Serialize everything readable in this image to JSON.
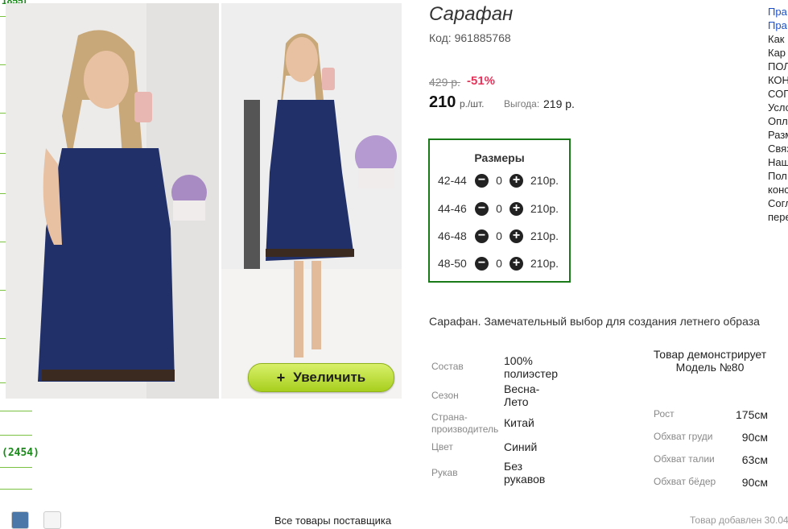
{
  "sidebar": {
    "top_fragment": "1855)",
    "count": "(2454)"
  },
  "gallery": {
    "zoom_label": "Увеличить",
    "zoom_icon": "plus-icon"
  },
  "product": {
    "title": "Сарафан",
    "code": "Код: 961885768",
    "old_price": "429 р.",
    "discount": "-51%",
    "price": "210",
    "price_unit": "р./шт.",
    "benefit_label": "Выгода:",
    "benefit_value": "219 р."
  },
  "sizes": {
    "title": "Размеры",
    "rows": [
      {
        "size": "42-44",
        "qty": "0",
        "price": "210р."
      },
      {
        "size": "44-46",
        "qty": "0",
        "price": "210р."
      },
      {
        "size": "46-48",
        "qty": "0",
        "price": "210р."
      },
      {
        "size": "48-50",
        "qty": "0",
        "price": "210р."
      }
    ]
  },
  "description": "Сарафан. Замечательный выбор для создания летнего образа",
  "attributes": [
    {
      "label": "Состав",
      "value": "100% полиэстер"
    },
    {
      "label": "Сезон",
      "value": "Весна-Лето"
    },
    {
      "label": "Страна-производитель",
      "value": "Китай"
    },
    {
      "label": "Цвет",
      "value": "Синий"
    },
    {
      "label": "Рукав",
      "value": "Без рукавов"
    }
  ],
  "model": {
    "heading": "Товар демонстрирует Модель №80",
    "measures": [
      {
        "label": "Рост",
        "value": "175см"
      },
      {
        "label": "Обхват груди",
        "value": "90см"
      },
      {
        "label": "Обхват талии",
        "value": "63см"
      },
      {
        "label": "Обхват бёдер",
        "value": "90см"
      }
    ]
  },
  "right_links": [
    "Пра",
    "Пра",
    "Как",
    "Кар",
    "ПОЛ",
    "КОН",
    "СОГ",
    "Усло",
    "Опл",
    "Разм",
    "Связ",
    "Нащ",
    "Пол",
    "конс",
    "Согл",
    "пере"
  ],
  "footer": {
    "supplier_link": "Все товары поставщика",
    "added": "Товар добавлен 30.04"
  },
  "colors": {
    "accent_green": "#1a7a1a",
    "discount": "#e8335a",
    "button": "#b8dc2a"
  }
}
